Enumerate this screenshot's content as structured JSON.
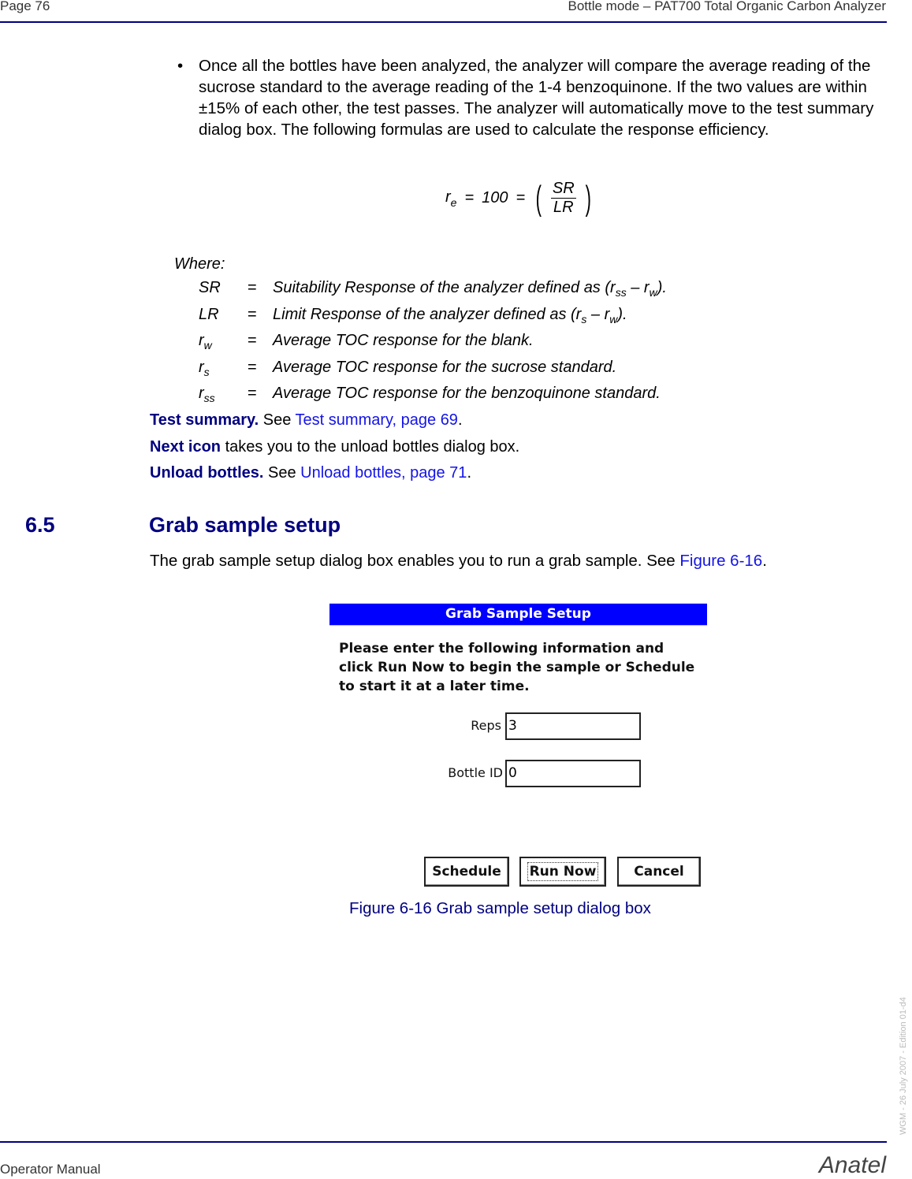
{
  "header": {
    "page_label": "Page 76",
    "chapter_title": "Bottle mode – PAT700 Total Organic Carbon Analyzer"
  },
  "bullet": {
    "symbol": "•",
    "text": "Once all the bottles have been analyzed, the analyzer will compare the average reading of the sucrose standard to the average reading of the 1-4 benzoquinone. If the two values are within ±15% of each other, the test passes. The analyzer will automatically move to the test summary dialog box. The following formulas are used to calculate the response efficiency."
  },
  "formula": {
    "lhs": "r",
    "lhs_sub": "e",
    "eq": "=",
    "const": "100",
    "eq2": "=",
    "numerator": "SR",
    "denominator": "LR"
  },
  "where_label": "Where:",
  "definitions": [
    {
      "term": "SR",
      "term_sub": "",
      "eq": "=",
      "desc_pre": "Suitability Response of the analyzer defined as (r",
      "sub1": "ss",
      "mid": " – r",
      "sub2": "w",
      "post": ")."
    },
    {
      "term": "LR",
      "term_sub": "",
      "eq": "=",
      "desc_pre": "Limit Response of the analyzer defined as (r",
      "sub1": "s",
      "mid": " – r",
      "sub2": "w",
      "post": ")."
    },
    {
      "term": "r",
      "term_sub": "w",
      "eq": "=",
      "desc": "Average TOC response for the blank."
    },
    {
      "term": "r",
      "term_sub": "s",
      "eq": "=",
      "desc": "Average TOC response for the sucrose standard."
    },
    {
      "term": "r",
      "term_sub": "ss",
      "eq": "=",
      "desc": "Average TOC response for the benzoquinone standard."
    }
  ],
  "references": [
    {
      "bold": "Test summary.",
      "text": " See ",
      "link": "Test summary, page 69",
      "tail": "."
    },
    {
      "bold": "Next icon",
      "text": " takes you to the unload bottles dialog box.",
      "link": "",
      "tail": ""
    },
    {
      "bold": "Unload bottles.",
      "text": " See ",
      "link": "Unload bottles, page 71",
      "tail": "."
    }
  ],
  "section": {
    "number": "6.5",
    "title": "Grab sample setup",
    "intro": "The grab sample setup dialog box enables you to run a grab sample. See ",
    "intro_link": "Figure 6-16",
    "intro_tail": "."
  },
  "dialog": {
    "title": "Grab Sample Setup",
    "message_lines": [
      "Please enter the following information and",
      "click Run Now to begin the sample or Schedule",
      "to start it at a later time."
    ],
    "fields": [
      {
        "label": "Reps",
        "value": "3"
      },
      {
        "label": "Bottle ID",
        "value": "0"
      }
    ],
    "buttons": {
      "schedule": "Schedule",
      "run_now": "Run Now",
      "cancel": "Cancel"
    },
    "title_color": "#0000ff"
  },
  "figure_caption": "Figure 6-16 Grab sample setup dialog box",
  "side_note": "WGM - 26 July 2007 - Edition 01-d4",
  "footer": {
    "left": "Operator Manual",
    "brand": "Anatel"
  }
}
